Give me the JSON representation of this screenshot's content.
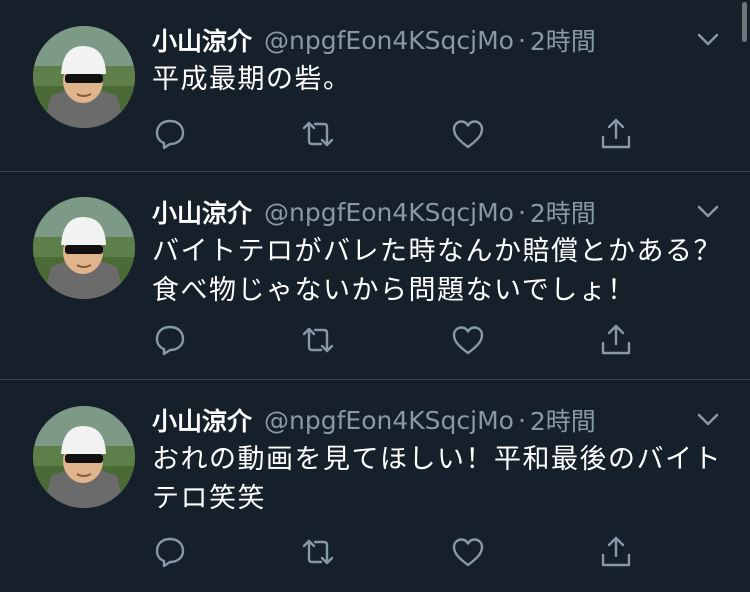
{
  "tweets": [
    {
      "author": "小山涼介",
      "handle": "@npgfEon4KSqcjMo",
      "separator": "·",
      "time": "2時間",
      "text": "平成最期の砦。"
    },
    {
      "author": "小山涼介",
      "handle": "@npgfEon4KSqcjMo",
      "separator": "·",
      "time": "2時間",
      "text_lines": [
        "バイトテロがバレた時なんか賠償とかある？",
        "食べ物じゃないから問題ないでしょ！"
      ]
    },
    {
      "author": "小山涼介",
      "handle": "@npgfEon4KSqcjMo",
      "separator": "·",
      "time": "2時間",
      "text_lines": [
        "おれの動画を見てほしい！平和最後のバイト",
        "テロ笑笑"
      ]
    }
  ],
  "icons": {
    "reply": "reply-icon",
    "retweet": "retweet-icon",
    "like": "like-icon",
    "share": "share-icon",
    "caret": "chevron-down-icon"
  },
  "colors": {
    "background": "#15202b",
    "secondary_text": "#8899a6",
    "divider": "#38444d"
  }
}
